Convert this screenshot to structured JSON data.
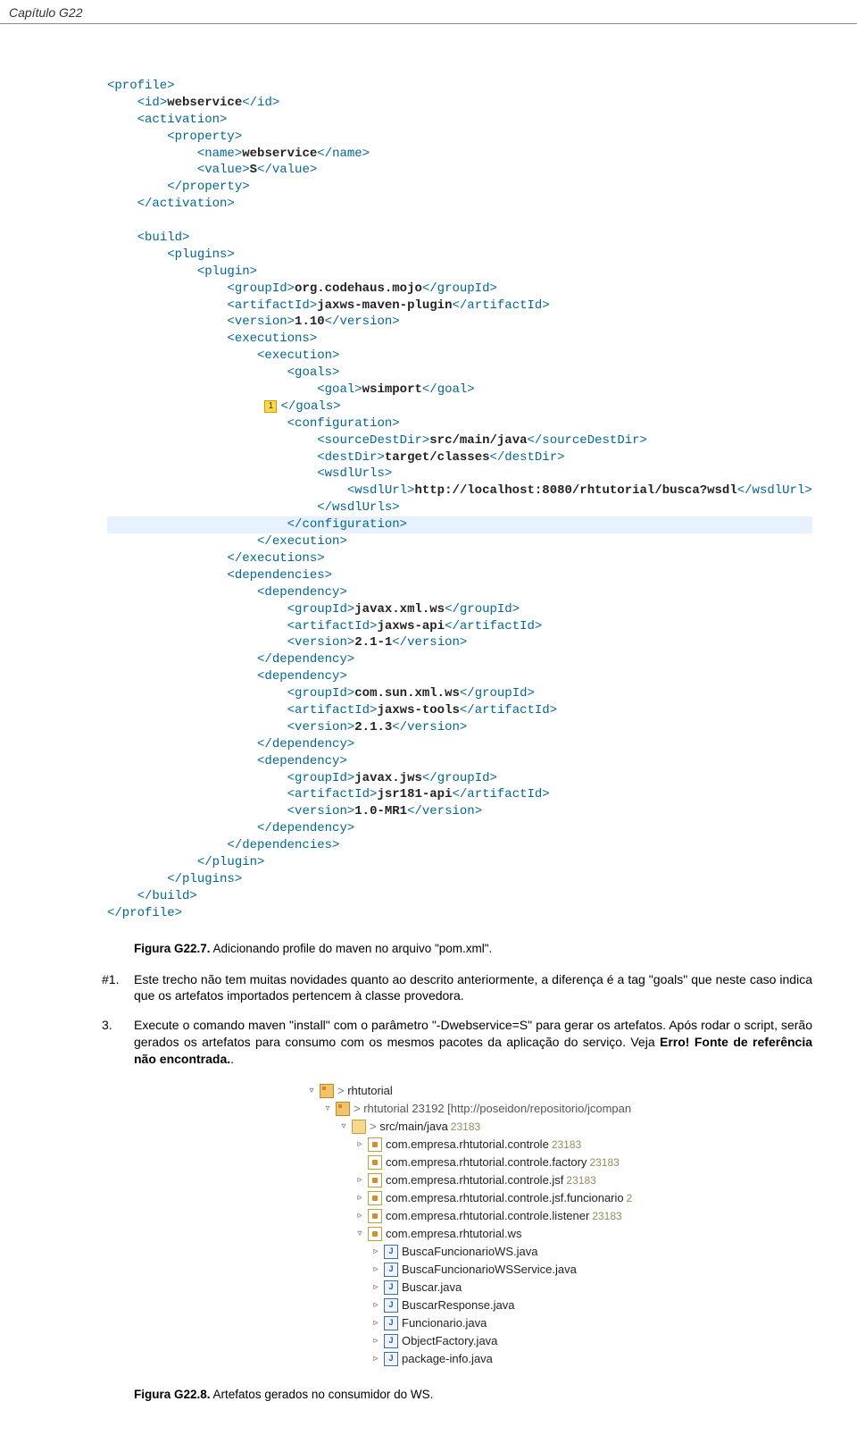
{
  "header": {
    "chapter": "Capítulo G22"
  },
  "code": {
    "sourceDestDir": "src/main/java",
    "destDir": "target/classes",
    "wsdlUrl": "http://localhost:8080/rhtutorial/busca?wsdl",
    "marker": "1"
  },
  "captions": {
    "fig7_label": "Figura G22.7.",
    "fig7_text": " Adicionando profile do maven no arquivo \"pom.xml\".",
    "fig8_label": "Figura G22.8.",
    "fig8_text": " Artefatos gerados no consumidor do WS."
  },
  "paras": {
    "p1_num": "#1.",
    "p1": "Este trecho não tem muitas novidades quanto ao descrito anteriormente, a diferença é a tag \"goals\" que neste caso indica que os artefatos importados pertencem à classe provedora.",
    "p3_num": "3.",
    "p3a": "Execute o comando maven \"install\" com o parâmetro \"-Dwebservice=S\" para gerar os artefatos. Após rodar o script, serão gerados os artefatos para consumo com os mesmos pacotes da aplicação do serviço. Veja ",
    "p3b": "Erro! Fonte de referência não encontrada.",
    "p3c": "."
  },
  "tree": {
    "root": "rhtutorial",
    "module": "rhtutorial 23192 [http://poseidon/repositorio/jcompan",
    "src": "src/main/java",
    "src_rev": "23183",
    "pkg1": "com.empresa.rhtutorial.controle",
    "pkg1_rev": "23183",
    "pkg2": "com.empresa.rhtutorial.controle.factory",
    "pkg2_rev": "23183",
    "pkg3": "com.empresa.rhtutorial.controle.jsf",
    "pkg3_rev": "23183",
    "pkg4": "com.empresa.rhtutorial.controle.jsf.funcionario",
    "pkg4_rev": "2",
    "pkg5": "com.empresa.rhtutorial.controle.listener",
    "pkg5_rev": "23183",
    "pkg6": "com.empresa.rhtutorial.ws",
    "f1": "BuscaFuncionarioWS.java",
    "f2": "BuscaFuncionarioWSService.java",
    "f3": "Buscar.java",
    "f4": "BuscarResponse.java",
    "f5": "Funcionario.java",
    "f6": "ObjectFactory.java",
    "f7": "package-info.java"
  }
}
